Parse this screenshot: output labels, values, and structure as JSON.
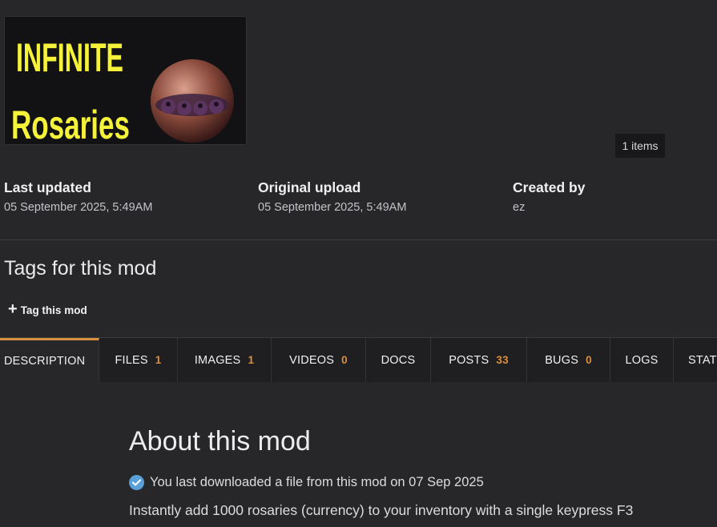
{
  "thumbnail": {
    "line1": "INFINITE",
    "line2": "Rosaries",
    "text_color": "#f5f23a",
    "icon": "rosary-orb-icon"
  },
  "gallery": {
    "items_label": "1 items"
  },
  "meta": {
    "last_updated": {
      "label": "Last updated",
      "value": "05 September 2025, 5:49AM"
    },
    "original_upload": {
      "label": "Original upload",
      "value": "05 September 2025, 5:49AM"
    },
    "created_by": {
      "label": "Created by",
      "value": "ez"
    }
  },
  "tags": {
    "title": "Tags for this mod",
    "tag_button": "Tag this mod"
  },
  "tabs": [
    {
      "label": "DESCRIPTION",
      "count": ""
    },
    {
      "label": "FILES",
      "count": "1"
    },
    {
      "label": "IMAGES",
      "count": "1"
    },
    {
      "label": "VIDEOS",
      "count": "0"
    },
    {
      "label": "DOCS",
      "count": ""
    },
    {
      "label": "POSTS",
      "count": "33"
    },
    {
      "label": "BUGS",
      "count": "0"
    },
    {
      "label": "LOGS",
      "count": ""
    },
    {
      "label": "STATS",
      "count": ""
    }
  ],
  "about": {
    "title": "About this mod",
    "download_note": "You last downloaded a file from this mod on 07 Sep 2025",
    "description": "Instantly add 1000 rosaries (currency) to your inventory with a single keypress F3"
  },
  "colors": {
    "accent": "#d98f40",
    "background": "#27272a",
    "tabbar": "#1f1f22",
    "check": "#5aa0d8"
  }
}
